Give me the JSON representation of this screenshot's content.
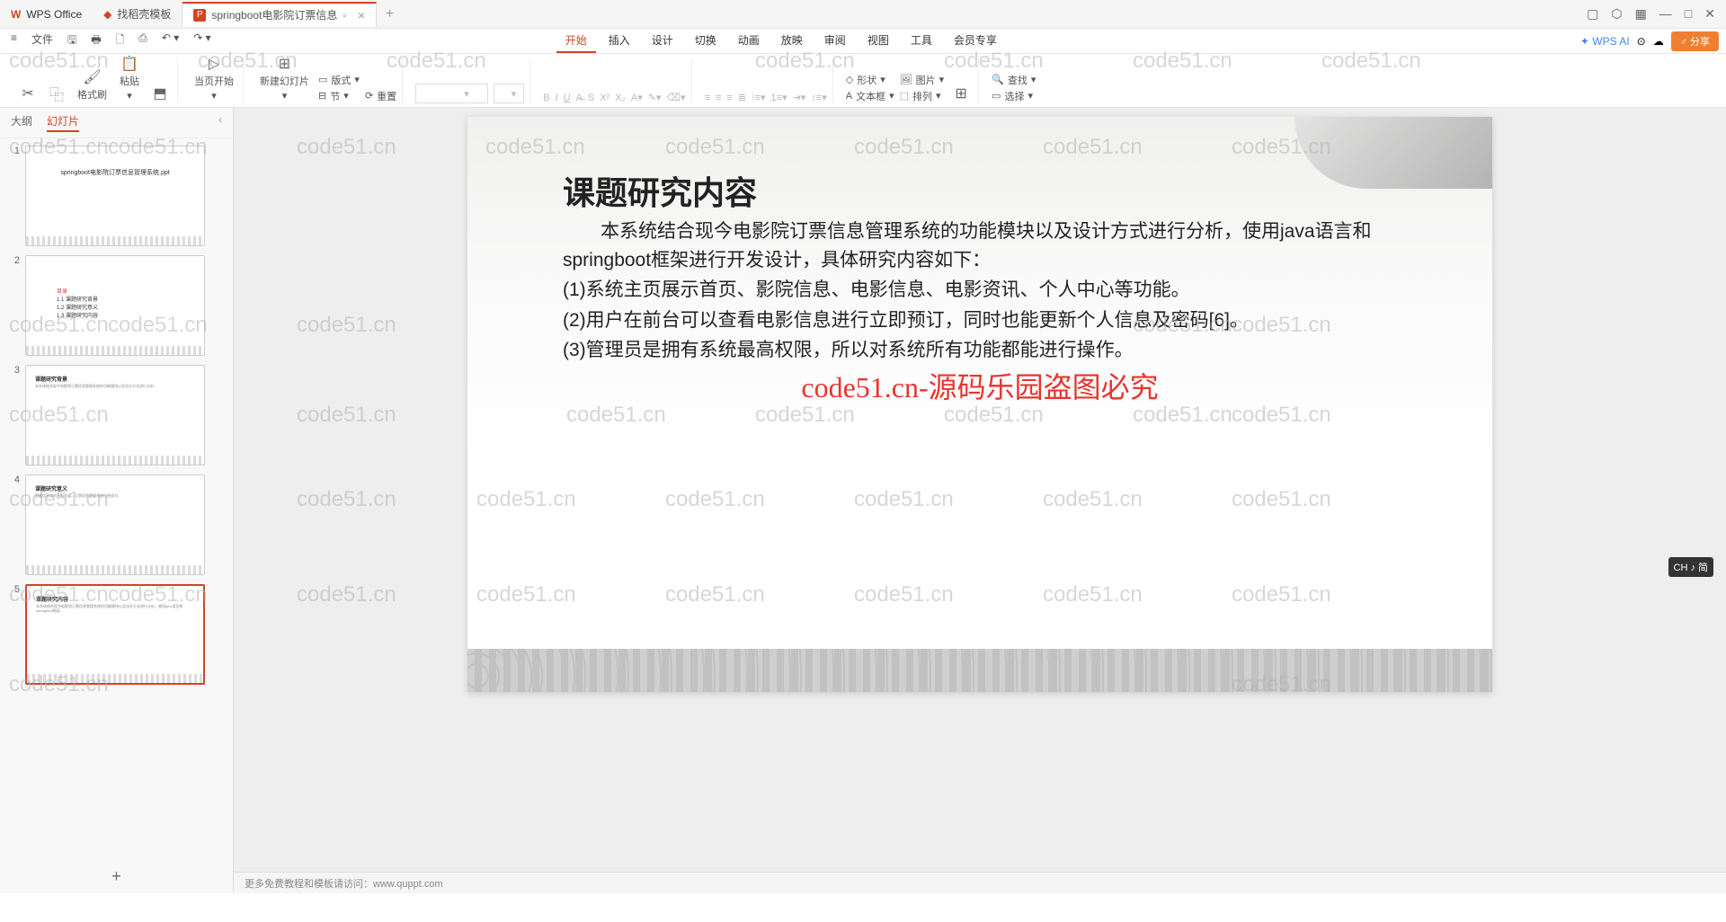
{
  "titlebar": {
    "app_name": "WPS Office",
    "tab1": "找稻壳模板",
    "tab2": "springboot电影院订票信息",
    "add": "+"
  },
  "window_controls": {
    "min": "—",
    "max": "□",
    "close": "✕"
  },
  "menubar": {
    "file": "文件",
    "items": [
      "开始",
      "插入",
      "设计",
      "切换",
      "动画",
      "放映",
      "审阅",
      "视图",
      "工具",
      "会员专享"
    ],
    "wps_ai": "WPS AI",
    "share": "分享"
  },
  "toolbar": {
    "format_painter": "格式刷",
    "paste": "粘贴",
    "home_start": "当页开始",
    "new_slide": "新建幻灯片",
    "layout": "版式",
    "reset": "重置",
    "section": "节",
    "shape": "形状",
    "picture": "图片",
    "textbox": "文本框",
    "arrange": "排列",
    "find": "查找",
    "select": "选择"
  },
  "sidebar": {
    "tab_outline": "大纲",
    "tab_slides": "幻灯片",
    "thumbs": [
      {
        "num": "1",
        "title": "springboot电影院订票信息管理系统.ppt"
      },
      {
        "num": "2",
        "lines": [
          "目录",
          "1.1 课题研究背景",
          "1.2 课题研究意义",
          "1.3 课题研究内容"
        ]
      },
      {
        "num": "3",
        "title": "课题研究背景"
      },
      {
        "num": "4",
        "title": "课题研究意义"
      },
      {
        "num": "5",
        "title": "课题研究内容"
      }
    ]
  },
  "slide": {
    "title": "课题研究内容",
    "body_indent": "　　本系统结合现今电影院订票信息管理系统的功能模块以及设计方式进行分析，使用java语言和springboot框架进行开发设计，具体研究内容如下：",
    "b1": "(1)系统主页展示首页、影院信息、电影信息、电影资讯、个人中心等功能。",
    "b2": "(2)用户在前台可以查看电影信息进行立即预订，同时也能更新个人信息及密码[6]。",
    "b3": "(3)管理员是拥有系统最高权限，所以对系统所有功能都能进行操作。",
    "watermark_red": "code51.cn-源码乐园盗图必究"
  },
  "footer": {
    "tip": "更多免费教程和模板请访问：www.quppt.com"
  },
  "ime": "CH ♪ 简",
  "wm_text": "code51.cn"
}
